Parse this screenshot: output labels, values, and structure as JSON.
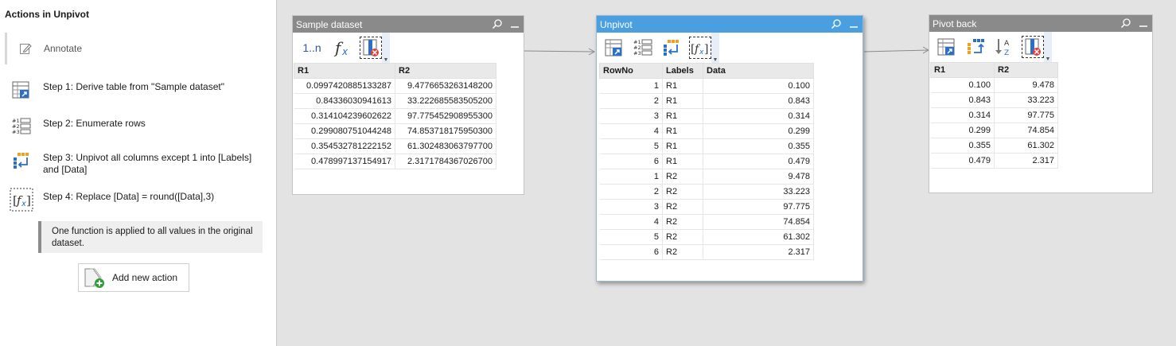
{
  "panel": {
    "title": "Actions in Unpivot",
    "annotate_label": "Annotate",
    "steps": [
      {
        "text": "Step 1: Derive table from \"Sample dataset\"",
        "icon": "derive-table-icon"
      },
      {
        "text": "Step 2: Enumerate rows",
        "icon": "enumerate-rows-icon"
      },
      {
        "text": "Step 3: Unpivot all columns except 1 into [Labels] and [Data]",
        "icon": "unpivot-icon"
      },
      {
        "text": "Step 4: Replace [Data] = round([Data],3)",
        "icon": "formula-icon"
      }
    ],
    "note": "One function is applied to all values in the original dataset.",
    "add_action_label": "Add new action"
  },
  "nodes": {
    "sample": {
      "title": "Sample dataset",
      "tool_enumerate": "1..n",
      "columns": [
        "R1",
        "R2"
      ],
      "rows": [
        [
          "0.0997420885133287",
          "9.4776653263148200"
        ],
        [
          "0.84336030941613",
          "33.222685583505200"
        ],
        [
          "0.314104239602622",
          "97.775452908955300"
        ],
        [
          "0.299080751044248",
          "74.853718175950300"
        ],
        [
          "0.354532781222152",
          "61.302483063797700"
        ],
        [
          "0.478997137154917",
          "2.3171784367026700"
        ]
      ]
    },
    "unpivot": {
      "title": "Unpivot",
      "columns": [
        "RowNo",
        "Labels",
        "Data"
      ],
      "rows": [
        [
          "1",
          "R1",
          "0.100"
        ],
        [
          "2",
          "R1",
          "0.843"
        ],
        [
          "3",
          "R1",
          "0.314"
        ],
        [
          "4",
          "R1",
          "0.299"
        ],
        [
          "5",
          "R1",
          "0.355"
        ],
        [
          "6",
          "R1",
          "0.479"
        ],
        [
          "1",
          "R2",
          "9.478"
        ],
        [
          "2",
          "R2",
          "33.223"
        ],
        [
          "3",
          "R2",
          "97.775"
        ],
        [
          "4",
          "R2",
          "74.854"
        ],
        [
          "5",
          "R2",
          "61.302"
        ],
        [
          "6",
          "R2",
          "2.317"
        ]
      ]
    },
    "pivot": {
      "title": "Pivot back",
      "columns": [
        "R1",
        "R2"
      ],
      "rows": [
        [
          "0.100",
          "9.478"
        ],
        [
          "0.843",
          "33.223"
        ],
        [
          "0.314",
          "97.775"
        ],
        [
          "0.299",
          "74.854"
        ],
        [
          "0.355",
          "61.302"
        ],
        [
          "0.479",
          "2.317"
        ]
      ]
    }
  },
  "colors": {
    "active_header": "#4a9fe0",
    "inactive_header": "#8a8a8a",
    "accent_blue": "#2a6fc9",
    "accent_orange": "#f0a020",
    "error_red": "#e04040"
  }
}
